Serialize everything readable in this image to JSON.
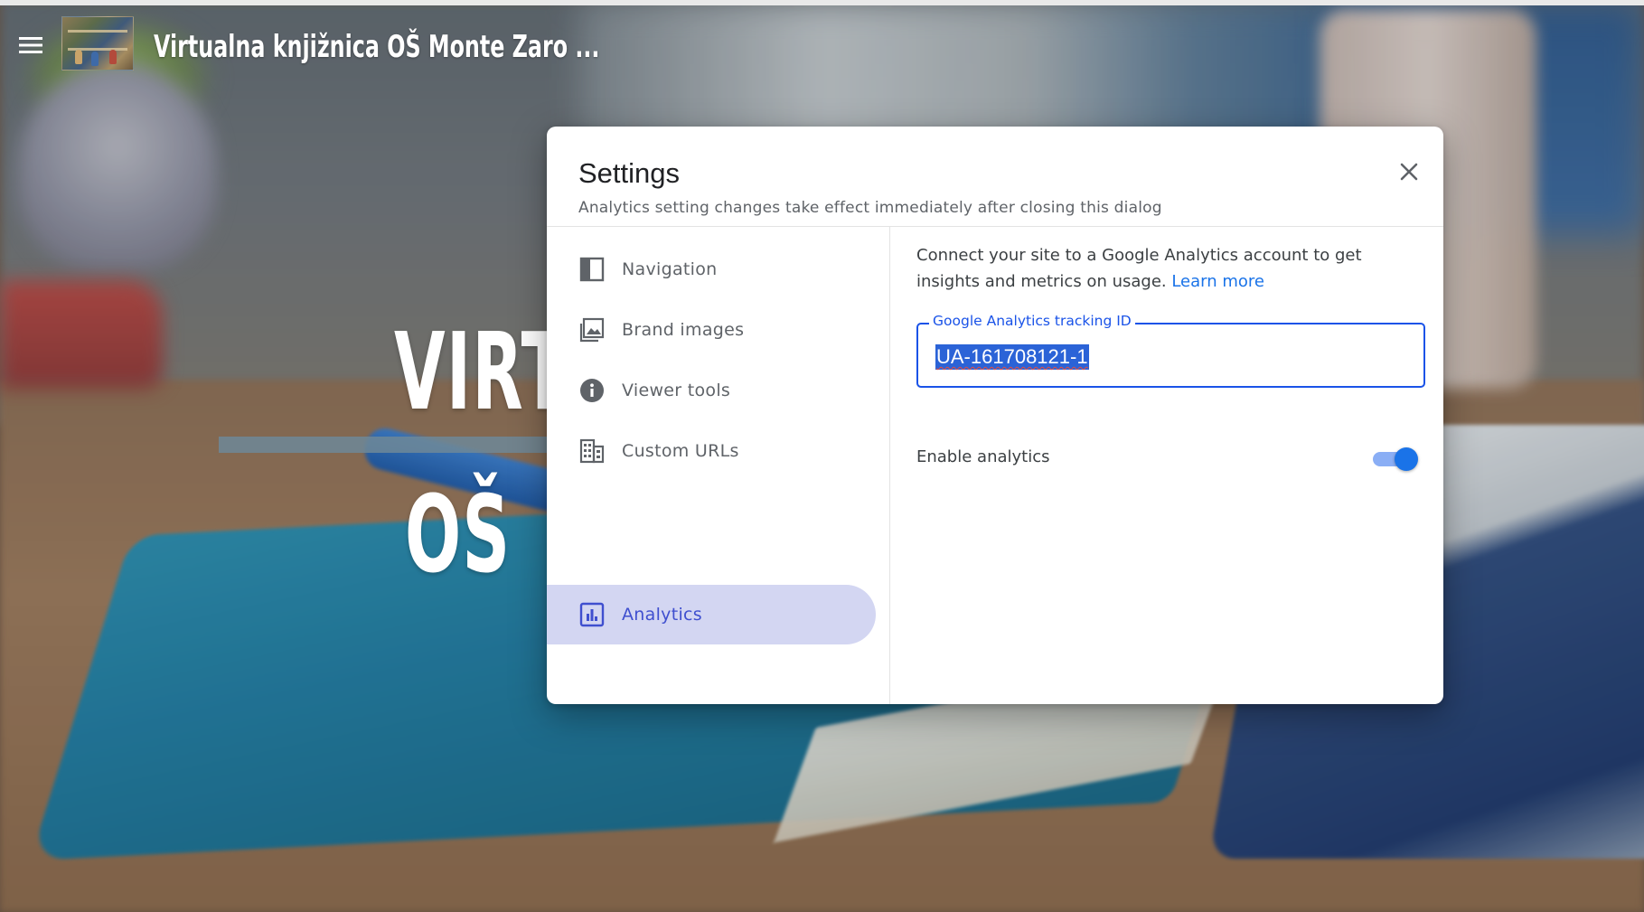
{
  "header": {
    "menu_icon": "hamburger-menu-icon",
    "logo_icon": "library-photo-logo",
    "site_title": "Virtualna knjižnica OŠ Monte Zaro ..."
  },
  "background": {
    "hero_line1": "VIRT",
    "hero_line2": "OŠ"
  },
  "dialog": {
    "title": "Settings",
    "subtitle": "Analytics setting changes take effect immediately after closing this dialog",
    "close_icon": "close-icon",
    "sidebar": {
      "items": [
        {
          "label": "Navigation",
          "icon": "navigation-layout-icon",
          "active": false
        },
        {
          "label": "Brand images",
          "icon": "image-icon",
          "active": false
        },
        {
          "label": "Viewer tools",
          "icon": "info-icon",
          "active": false
        },
        {
          "label": "Custom URLs",
          "icon": "building-icon",
          "active": false
        },
        {
          "label": "Analytics",
          "icon": "analytics-chart-icon",
          "active": true
        }
      ]
    },
    "content": {
      "description": "Connect your site to a Google Analytics account to get insights and metrics on usage.",
      "learn_more": "Learn more",
      "tracking_field": {
        "label": "Google Analytics tracking ID",
        "value": "UA-161708121-1",
        "text_selected": true
      },
      "enable_analytics": {
        "label": "Enable analytics",
        "checked": true
      }
    }
  },
  "colors": {
    "accent": "#1a53e8",
    "link": "#1a73e8",
    "active_nav_bg": "#d3d6f2",
    "active_nav_text": "#3f4fcf",
    "toggle_track": "#8aaef5",
    "toggle_thumb": "#1a73e8"
  }
}
